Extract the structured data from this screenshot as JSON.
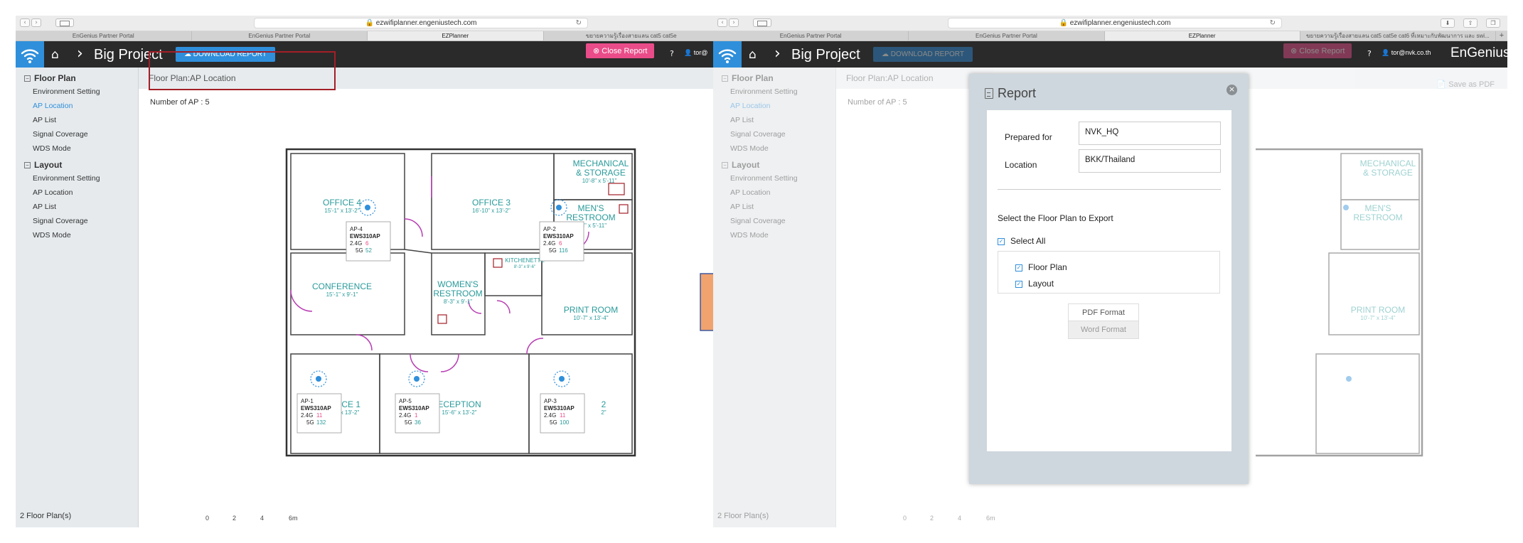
{
  "left": {
    "url": "ezwifiplanner.engeniustech.com",
    "tabs": [
      "EnGenius Partner Portal",
      "EnGenius Partner Portal",
      "EZPlanner",
      "ขยายความรู้เรื่องสายแลน cat5 cat5e"
    ],
    "active_tab": 2,
    "project": "Big Project",
    "download": "DOWNLOAD REPORT",
    "close_report": "Close Report",
    "user": "tor@",
    "floor_plan_title": "Floor Plan:AP Location",
    "ap_count": "Number of AP : 5",
    "plans_count": "2 Floor Plan(s)"
  },
  "right": {
    "url": "ezwifiplanner.engeniustech.com",
    "tabs": [
      "EnGenius Partner Portal",
      "EnGenius Partner Portal",
      "EZPlanner",
      "ขยายความรู้เรื่องสายแลน cat5 cat5e cat6 ที่เหมาะกับพัฒนาการ และ swi..."
    ],
    "active_tab": 2,
    "project": "Big Project",
    "download": "DOWNLOAD REPORT",
    "close_report": "Close Report",
    "user": "tor@nvk.co.th",
    "brand": "EnGenius",
    "floor_plan_title": "Floor Plan:AP Location",
    "save_pdf": "Save as PDF",
    "ap_count": "Number of AP : 5",
    "plans_count": "2 Floor Plan(s)"
  },
  "sidebar": {
    "floor_plan": "Floor Plan",
    "layout": "Layout",
    "items": [
      "Environment Setting",
      "AP Location",
      "AP List",
      "Signal Coverage",
      "WDS Mode"
    ],
    "active_index": 1
  },
  "scale": [
    "0",
    "2",
    "4",
    "6m"
  ],
  "rooms": {
    "mech": "MECHANICAL",
    "mech2": "& STORAGE",
    "mech_dim": "10'-8\" x 5'-11\"",
    "mens": "MEN'S",
    "mens2": "RESTROOM",
    "mens_dim": "8'-3\" x 5'-11\"",
    "office4": "OFFICE 4",
    "office4_dim": "15'-1\" x 13'-2\"",
    "office3": "OFFICE 3",
    "office3_dim": "16'-10\" x 13'-2\"",
    "kitchen": "KITCHENETTE",
    "kitchen_dim": "8'-3\" x 9'-6\"",
    "conference": "CONFERENCE",
    "conference_dim": "15'-1\" x 9'-1\"",
    "womens": "WOMEN'S",
    "womens2": "RESTROOM",
    "womens_dim": "8'-3\" x 9'-1\"",
    "print": "PRINT ROOM",
    "print_dim": "10'-7\" x 13'-4\"",
    "office1": "ICE 1",
    "office1_dim": "x 13'-2\"",
    "reception": "ECEPTION",
    "reception_dim": "15'-6\" x 13'-2\"",
    "office2": "2",
    "office2_dim": "2\""
  },
  "aps": [
    {
      "name": "AP-4",
      "model": "EWS310AP",
      "g24": "6",
      "g5": "52"
    },
    {
      "name": "AP-2",
      "model": "EWS310AP",
      "g24": "6",
      "g5": "116"
    },
    {
      "name": "AP-1",
      "model": "EWS310AP",
      "g24": "11",
      "g5": "132"
    },
    {
      "name": "AP-5",
      "model": "EWS310AP",
      "g24": "1",
      "g5": "36"
    },
    {
      "name": "AP-3",
      "model": "EWS310AP",
      "g24": "11",
      "g5": "100"
    }
  ],
  "ap_labels": {
    "g24": "2.4G",
    "g5": "5G"
  },
  "modal": {
    "title": "Report",
    "prepared_for_label": "Prepared for",
    "prepared_for_value": "NVK_HQ",
    "location_label": "Location",
    "location_value": "BKK/Thailand",
    "select_label": "Select the Floor Plan to Export",
    "select_all": "Select All",
    "floor_plan": "Floor Plan",
    "layout": "Layout",
    "pdf": "PDF Format",
    "word": "Word Format"
  },
  "colors": {
    "accent": "#2f8fdb",
    "pink": "#ea4c89",
    "room_text": "#2a9a9a",
    "highlight": "#a41f27",
    "arrow": "#f0a36f"
  }
}
